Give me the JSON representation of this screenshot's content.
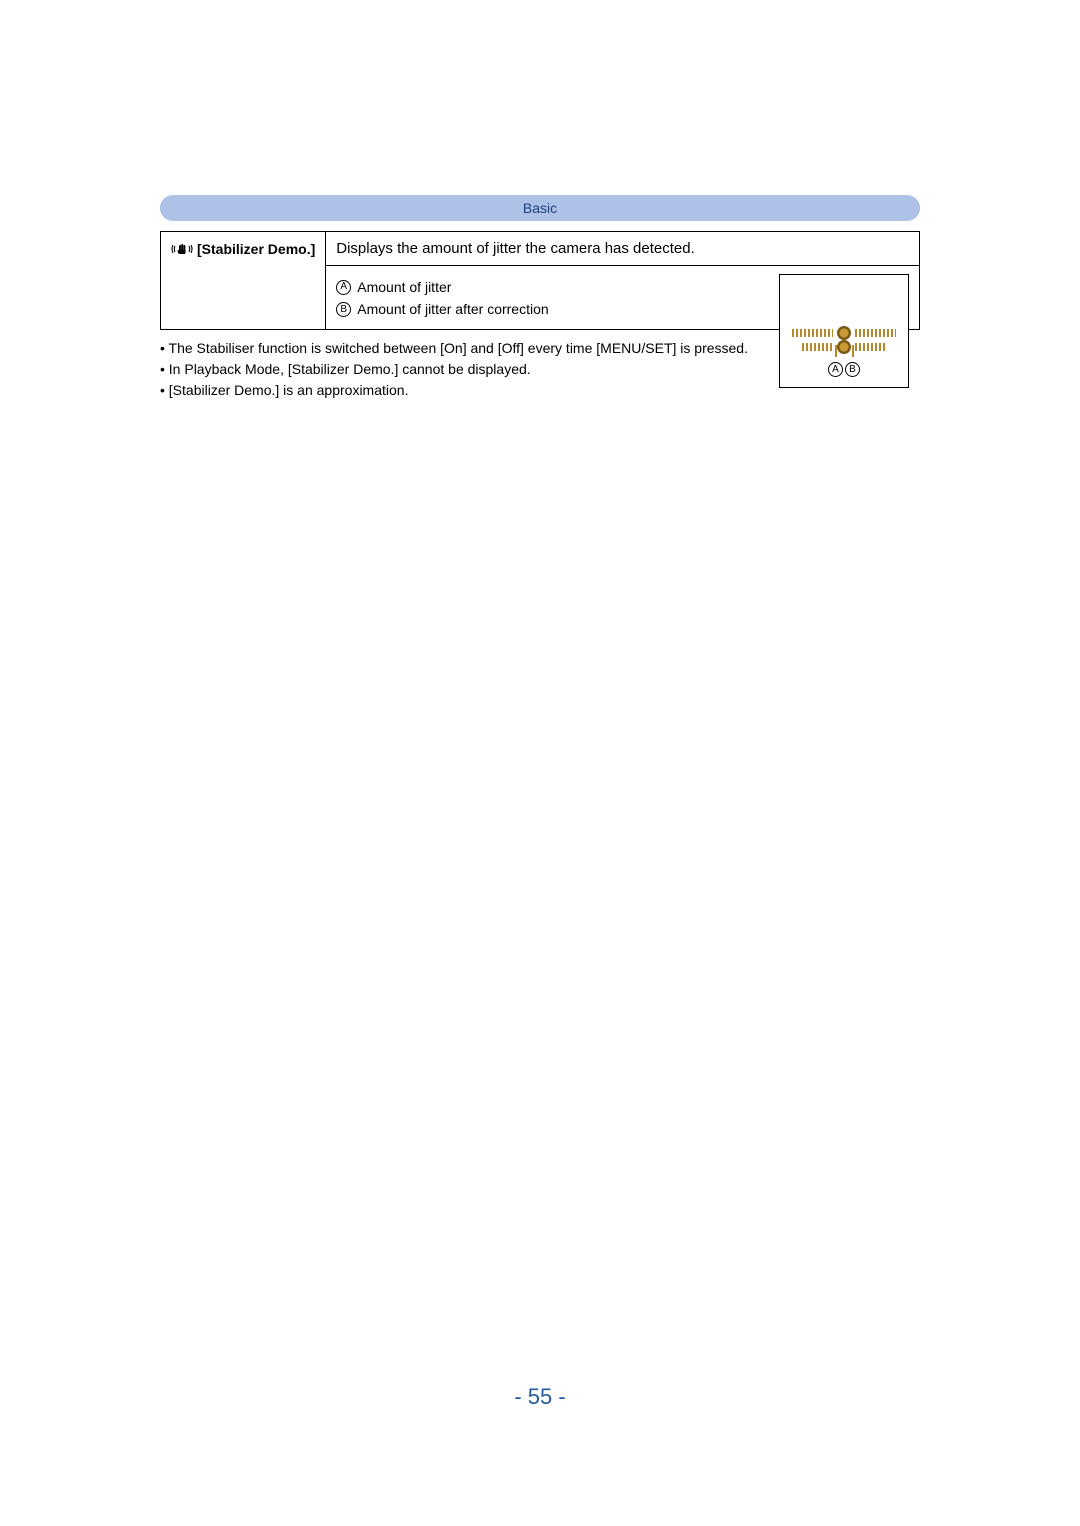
{
  "header": {
    "title": "Basic"
  },
  "feature": {
    "label": "[Stabilizer Demo.]",
    "icon_name": "stabilizer-hand-icon",
    "description": "Displays the amount of jitter the camera has detected.",
    "legend": {
      "a": {
        "mark": "A",
        "text": " Amount of jitter"
      },
      "b": {
        "mark": "B",
        "text": " Amount of jitter after correction"
      }
    },
    "preview": {
      "marker_a": "A",
      "marker_b": "B"
    }
  },
  "notes": {
    "n1": "The Stabiliser function is switched between [On] and [Off] every time [MENU/SET] is pressed.",
    "n2": "In Playback Mode, [Stabilizer Demo.] cannot be displayed.",
    "n3": "[Stabilizer Demo.] is an approximation."
  },
  "page_number": "- 55 -"
}
